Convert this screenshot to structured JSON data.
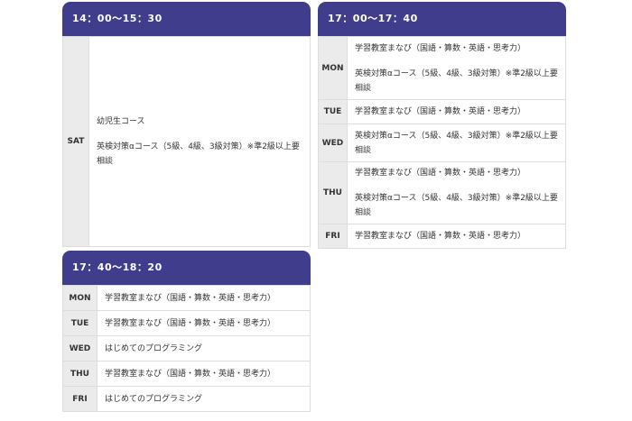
{
  "blocks": [
    {
      "time": "14：00～15：30",
      "rows": [
        {
          "day": "SAT",
          "lines": [
            "幼児生コース",
            "",
            "英検対策αコース（5級、4級、3級対策）※準2級以上要相談"
          ]
        }
      ]
    },
    {
      "time": "17：00～17：40",
      "rows": [
        {
          "day": "MON",
          "lines": [
            "学習教室まなび（国語・算数・英語・思考力）",
            "",
            "英検対策αコース（5級、4級、3級対策）※準2級以上要相談"
          ]
        },
        {
          "day": "TUE",
          "lines": [
            "学習教室まなび（国語・算数・英語・思考力）"
          ]
        },
        {
          "day": "WED",
          "lines": [
            "英検対策αコース（5級、4級、3級対策）※準2級以上要相談"
          ]
        },
        {
          "day": "THU",
          "lines": [
            "学習教室まなび（国語・算数・英語・思考力）",
            "",
            "英検対策αコース（5級、4級、3級対策）※準2級以上要相談"
          ]
        },
        {
          "day": "FRI",
          "lines": [
            "学習教室まなび（国語・算数・英語・思考力）"
          ]
        }
      ]
    },
    {
      "time": "17：40～18：20",
      "rows": [
        {
          "day": "MON",
          "lines": [
            "学習教室まなび（国語・算数・英語・思考力）"
          ]
        },
        {
          "day": "TUE",
          "lines": [
            "学習教室まなび（国語・算数・英語・思考力）"
          ]
        },
        {
          "day": "WED",
          "lines": [
            "はじめてのプログラミング"
          ]
        },
        {
          "day": "THU",
          "lines": [
            "学習教室まなび（国語・算数・英語・思考力）"
          ]
        },
        {
          "day": "FRI",
          "lines": [
            "はじめてのプログラミング"
          ]
        }
      ]
    }
  ]
}
